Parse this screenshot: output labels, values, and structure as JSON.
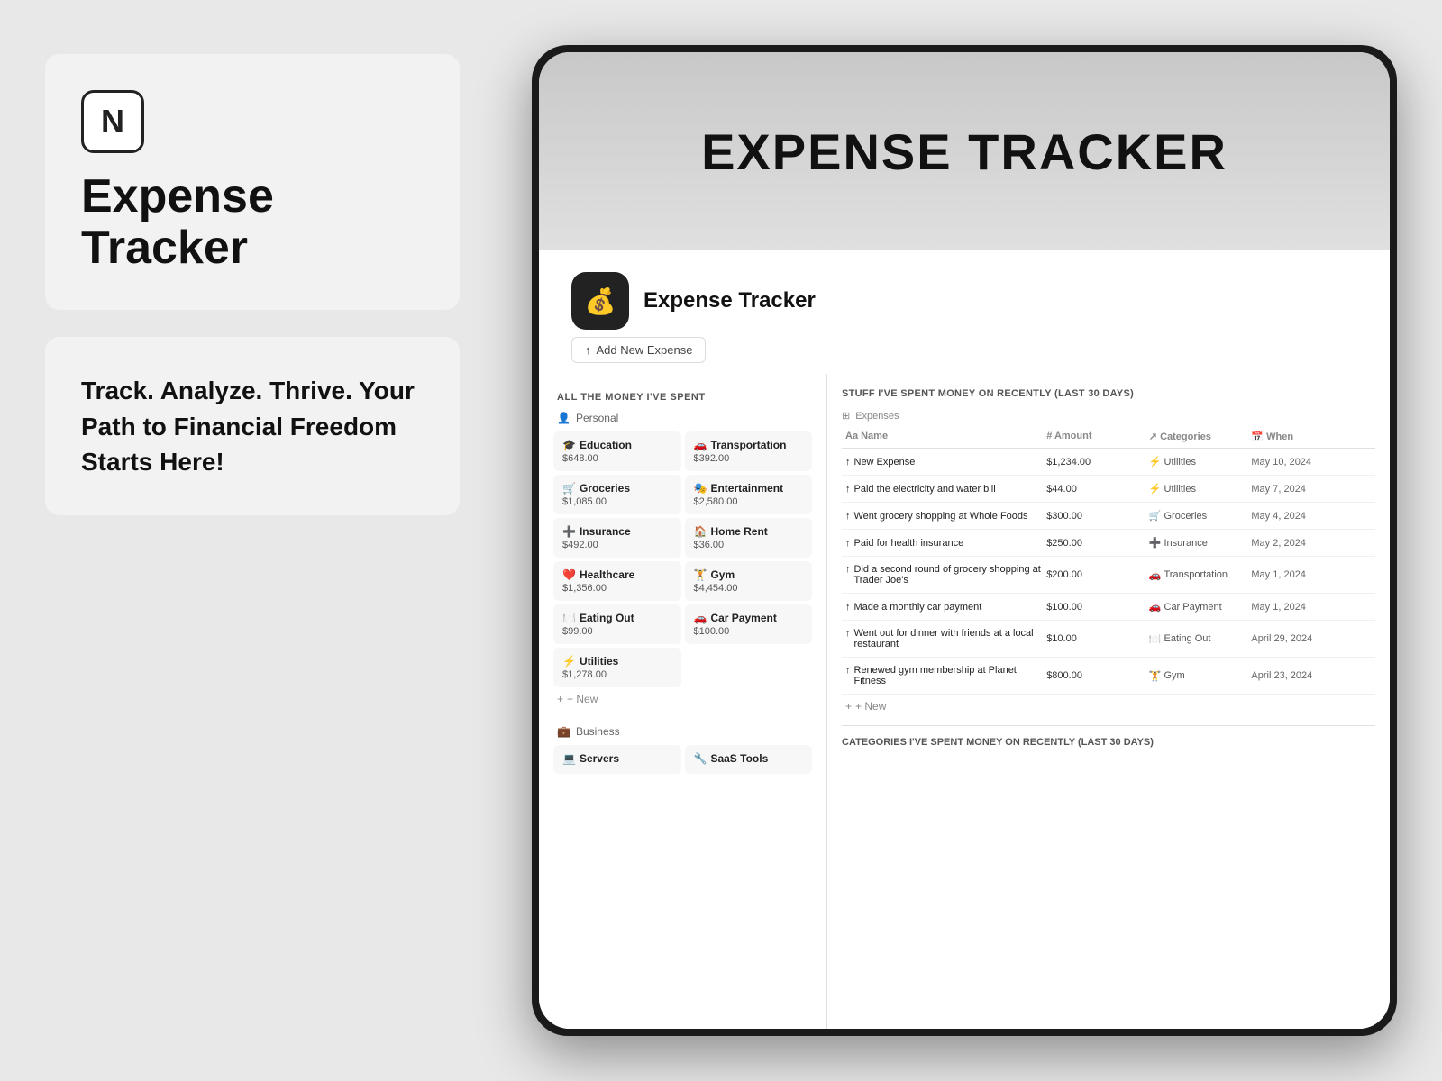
{
  "left": {
    "app_title_line1": "Expense",
    "app_title_line2": "Tracker",
    "tagline": "Track. Analyze. Thrive. Your Path to Financial Freedom Starts Here!",
    "notion_logo": "N"
  },
  "header": {
    "title": "EXPENSE TRACKER"
  },
  "app": {
    "name": "Expense Tracker",
    "add_expense_label": "Add New Expense"
  },
  "left_section": {
    "title": "ALL THE MONEY I'VE SPENT",
    "personal_label": "Personal",
    "categories": [
      {
        "icon": "🎓",
        "name": "Education",
        "amount": "$648.00"
      },
      {
        "icon": "🚗",
        "name": "Transportation",
        "amount": "$392.00"
      },
      {
        "icon": "🛒",
        "name": "Groceries",
        "amount": "$1,085.00"
      },
      {
        "icon": "🎭",
        "name": "Entertainment",
        "amount": "$2,580.00"
      },
      {
        "icon": "➕",
        "name": "Insurance",
        "amount": "$492.00"
      },
      {
        "icon": "🏠",
        "name": "Home Rent",
        "amount": "$36.00"
      },
      {
        "icon": "❤️",
        "name": "Healthcare",
        "amount": "$1,356.00"
      },
      {
        "icon": "🏋️",
        "name": "Gym",
        "amount": "$4,454.00"
      },
      {
        "icon": "🍽️",
        "name": "Eating Out",
        "amount": "$99.00"
      },
      {
        "icon": "🚗",
        "name": "Car Payment",
        "amount": "$100.00"
      },
      {
        "icon": "⚡",
        "name": "Utilities",
        "amount": "$1,278.00"
      }
    ],
    "new_label": "+ New",
    "business_label": "Business",
    "business_categories": [
      {
        "icon": "💻",
        "name": "Servers",
        "amount": ""
      },
      {
        "icon": "🔧",
        "name": "SaaS Tools",
        "amount": ""
      }
    ]
  },
  "right_section": {
    "title": "STUFF I'VE SPENT MONEY ON RECENTLY (LAST 30 DAYS)",
    "sub_label": "Expenses",
    "table_headers": {
      "name": "Aa Name",
      "amount": "# Amount",
      "categories": "↗ Categories",
      "when": "📅 When"
    },
    "expenses": [
      {
        "icon": "↑",
        "name": "New Expense",
        "amount": "$1,234.00",
        "category_icon": "⚡",
        "category": "Utilities",
        "date": "May 10, 2024"
      },
      {
        "icon": "↑",
        "name": "Paid the electricity and water bill",
        "amount": "$44.00",
        "category_icon": "⚡",
        "category": "Utilities",
        "date": "May 7, 2024"
      },
      {
        "icon": "↑",
        "name": "Went grocery shopping at Whole Foods",
        "amount": "$300.00",
        "category_icon": "🛒",
        "category": "Groceries",
        "date": "May 4, 2024"
      },
      {
        "icon": "↑",
        "name": "Paid for health insurance",
        "amount": "$250.00",
        "category_icon": "➕",
        "category": "Insurance",
        "date": "May 2, 2024"
      },
      {
        "icon": "↑",
        "name": "Did a second round of grocery shopping at Trader Joe's",
        "amount": "$200.00",
        "category_icon": "🚗",
        "category": "Transportation",
        "date": "May 1, 2024"
      },
      {
        "icon": "↑",
        "name": "Made a monthly car payment",
        "amount": "$100.00",
        "category_icon": "🚗",
        "category": "Car Payment",
        "date": "May 1, 2024"
      },
      {
        "icon": "↑",
        "name": "Went out for dinner with friends at a local restaurant",
        "amount": "$10.00",
        "category_icon": "🍽️",
        "category": "Eating Out",
        "date": "April 29, 2024"
      },
      {
        "icon": "↑",
        "name": "Renewed gym membership at Planet Fitness",
        "amount": "$800.00",
        "category_icon": "🏋️",
        "category": "Gym",
        "date": "April 23, 2024"
      }
    ],
    "new_row_label": "+ New",
    "categories_bottom_title": "CATEGORIES I'VE SPENT MONEY ON RECENTLY (LAST 30 DAYS)"
  }
}
